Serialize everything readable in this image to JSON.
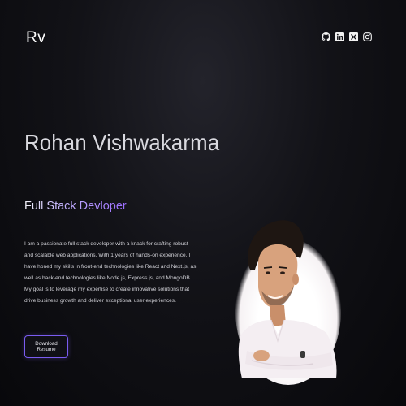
{
  "header": {
    "logo": "Rv",
    "socials": [
      {
        "icon": "github-icon"
      },
      {
        "icon": "linkedin-icon"
      },
      {
        "icon": "x-twitter-icon"
      },
      {
        "icon": "instagram-icon"
      }
    ]
  },
  "hero": {
    "name": "Rohan Vishwakarma",
    "role": "Full Stack Devloper",
    "bio": "I am a passionate full stack developer with a knack for crafting robust and scalable web applications. With 1 years of hands-on experience, I have honed my skills in front-end technologies like React and Next.js, as well as back-end technologies like Node.js, Express.js, and MongoDB. My goal is to leverage my expertise to create innovative solutions that drive business growth and deliver exceptional user experiences.",
    "cta_label": "Download Resume"
  },
  "colors": {
    "accent": "#7a5cf0",
    "background": "#121217"
  }
}
